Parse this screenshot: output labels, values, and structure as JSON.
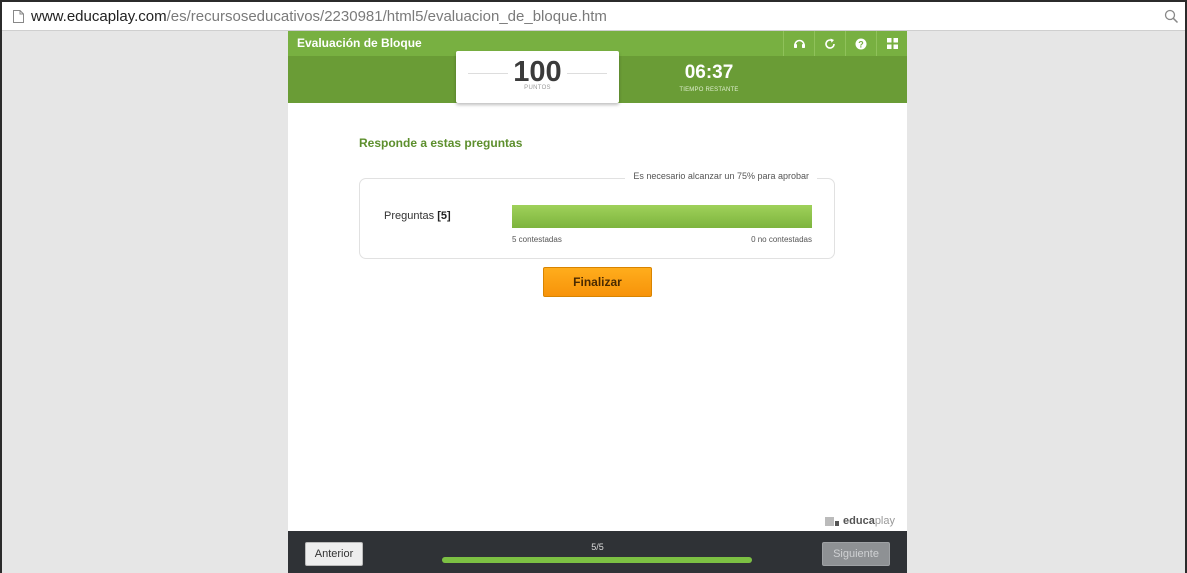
{
  "browser": {
    "url_host": "www.educaplay.com",
    "url_path": "/es/recursoseducativos/2230981/html5/evaluacion_de_bloque.htm"
  },
  "app": {
    "title": "Evaluación de Bloque",
    "tools": [
      "sound-icon",
      "restart-icon",
      "help-icon",
      "grid-icon"
    ],
    "score": {
      "value": "100",
      "label": "PUNTOS"
    },
    "timer": {
      "value": "06:37",
      "label": "TIEMPO RESTANTE"
    },
    "heading": "Responde a estas preguntas",
    "summary": {
      "requirement": "Es necesario alcanzar un 75% para aprobar",
      "questions_label": "Preguntas",
      "questions_count": "[5]",
      "answered": "5 contestadas",
      "unanswered": "0 no contestadas",
      "answered_fraction": 1.0
    },
    "finish_label": "Finalizar",
    "brand": {
      "part1": "educa",
      "part2": "play"
    },
    "footer": {
      "prev_label": "Anterior",
      "next_label": "Siguiente",
      "counter": "5/5",
      "progress_fraction": 1.0
    },
    "colors": {
      "header": "#78b041",
      "scorebar": "#6a9c36",
      "accent_orange": "#f7930a",
      "footer": "#2f3236"
    }
  }
}
